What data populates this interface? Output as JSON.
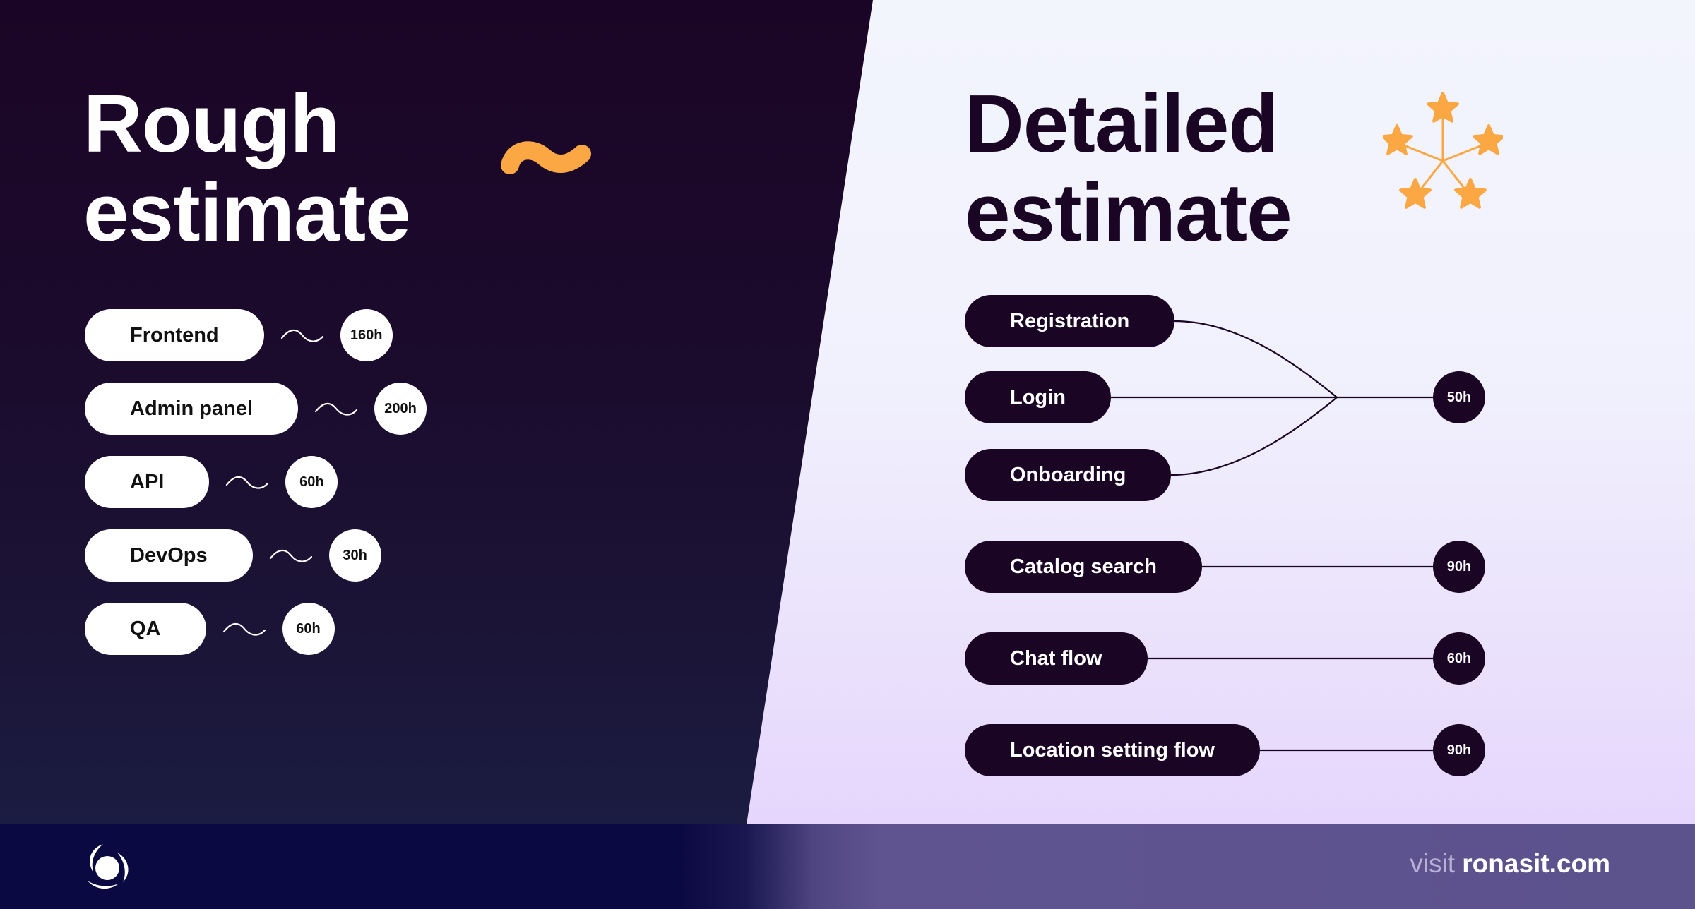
{
  "rough": {
    "title_line1": "Rough",
    "title_line2": "estimate",
    "decor_icon": "tilde-icon",
    "items": [
      {
        "label": "Frontend",
        "hours": "160h"
      },
      {
        "label": "Admin panel",
        "hours": "200h"
      },
      {
        "label": "API",
        "hours": "60h"
      },
      {
        "label": "DevOps",
        "hours": "30h"
      },
      {
        "label": "QA",
        "hours": "60h"
      }
    ]
  },
  "detailed": {
    "title_line1": "Detailed",
    "title_line2": "estimate",
    "decor_icon": "stars-network-icon",
    "groups": [
      {
        "items": [
          "Registration",
          "Login",
          "Onboarding"
        ],
        "hours": "50h"
      },
      {
        "items": [
          "Catalog search"
        ],
        "hours": "90h"
      },
      {
        "items": [
          "Chat flow"
        ],
        "hours": "60h"
      },
      {
        "items": [
          "Location setting flow"
        ],
        "hours": "90h"
      }
    ]
  },
  "footer": {
    "logo_icon": "ronas-it-logo-icon",
    "visit_label": "visit",
    "domain": "ronasit.com"
  },
  "colors": {
    "dark": "#1a0524",
    "accent_orange": "#fba744",
    "footer_purple": "#5c528c",
    "footer_navy": "#0b0941"
  }
}
